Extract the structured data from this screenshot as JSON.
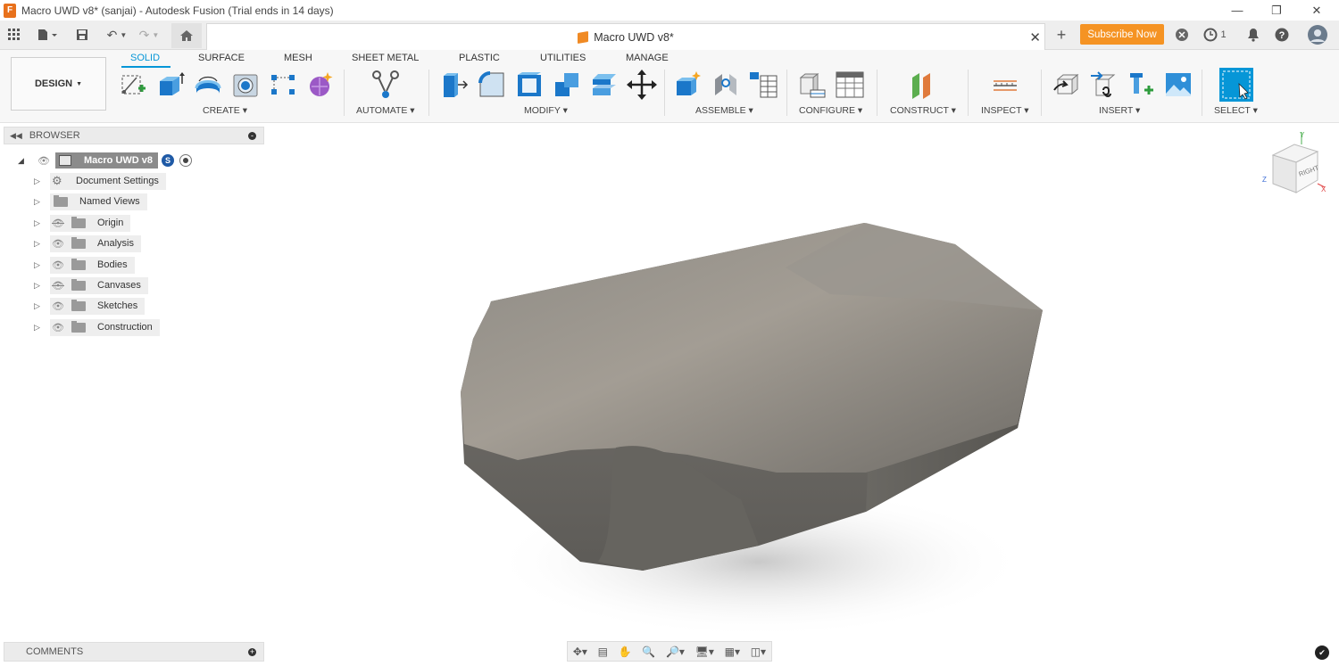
{
  "window": {
    "title": "Macro UWD v8* (sanjai) - Autodesk Fusion (Trial ends in 14 days)",
    "app_icon_letter": "F"
  },
  "appbar": {
    "document_tab": "Macro UWD v8*",
    "subscribe_label": "Subscribe Now",
    "job_count": "1"
  },
  "workspace": {
    "label": "DESIGN"
  },
  "tabs": [
    "SOLID",
    "SURFACE",
    "MESH",
    "SHEET METAL",
    "PLASTIC",
    "UTILITIES",
    "MANAGE"
  ],
  "groups": [
    "CREATE",
    "AUTOMATE",
    "MODIFY",
    "ASSEMBLE",
    "CONFIGURE",
    "CONSTRUCT",
    "INSPECT",
    "INSERT",
    "SELECT"
  ],
  "browser": {
    "header": "BROWSER",
    "root": "Macro UWD v8",
    "items": [
      "Document Settings",
      "Named Views",
      "Origin",
      "Analysis",
      "Bodies",
      "Canvases",
      "Sketches",
      "Construction"
    ]
  },
  "comments": {
    "header": "COMMENTS"
  },
  "viewcube": {
    "face": "RIGHT",
    "axis_x": "X",
    "axis_y": "Y",
    "axis_z": "Z"
  },
  "colors": {
    "accent": "#0696d7",
    "subscribe": "#f59323",
    "body": "#7d7a74"
  }
}
